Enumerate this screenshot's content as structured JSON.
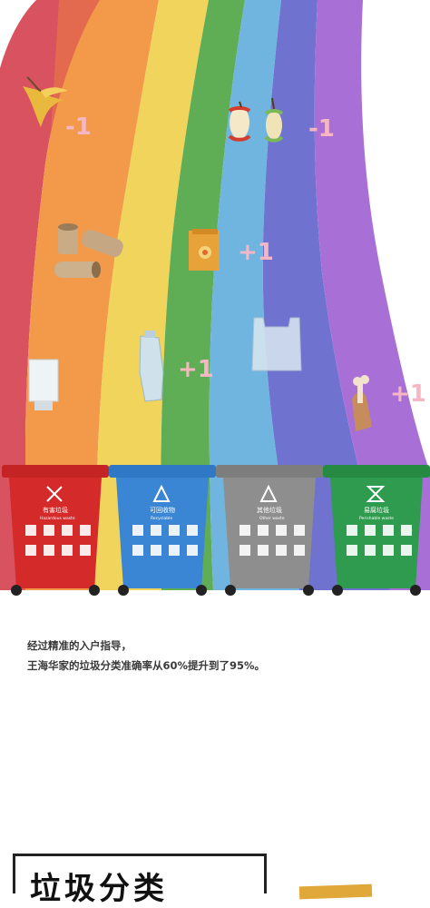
{
  "scores": {
    "banana": "-1",
    "apple": "-1",
    "juice_box": "+1",
    "bottle": "+1",
    "bone": "+1"
  },
  "bins": [
    {
      "label": "有害垃圾",
      "sub": "Hazardous waste",
      "color": "#d42a2a",
      "icon": "hazard-x-icon"
    },
    {
      "label": "可回收物",
      "sub": "Recyclable",
      "color": "#3a86d4",
      "icon": "recycle-icon"
    },
    {
      "label": "其他垃圾",
      "sub": "Other waste",
      "color": "#8e8e8e",
      "icon": "recycle-icon"
    },
    {
      "label": "易腐垃圾",
      "sub": "Perishable waste",
      "color": "#2f9b4e",
      "icon": "hourglass-icon"
    }
  ],
  "caption": {
    "line1": "经过精准的入户指导，",
    "line2": "王海华家的垃圾分类准确率从60%提升到了95%。"
  },
  "section_title": "垃圾分类"
}
